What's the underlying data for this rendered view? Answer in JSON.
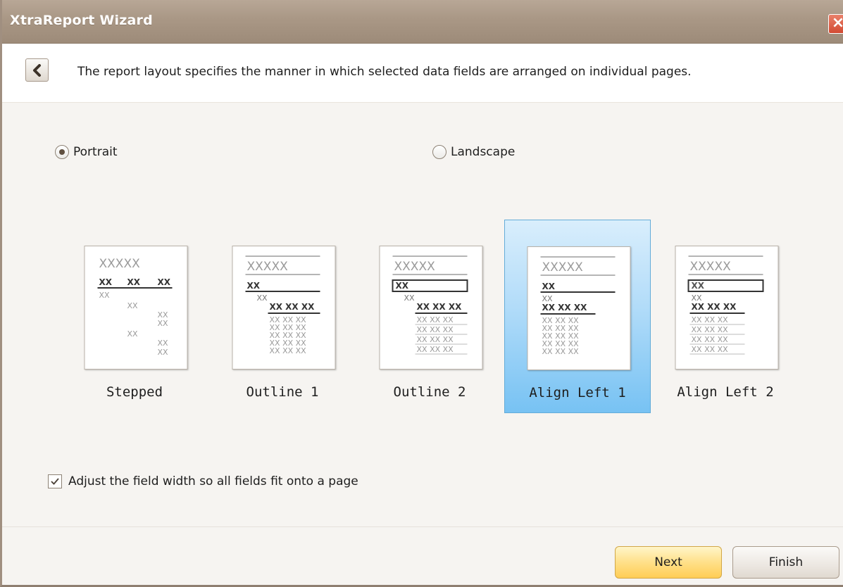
{
  "window": {
    "title": "XtraReport Wizard"
  },
  "header": {
    "description": "The report layout specifies the manner in which selected data fields are arranged on individual pages."
  },
  "orientation": {
    "options": [
      {
        "label": "Portrait",
        "selected": true
      },
      {
        "label": "Landscape",
        "selected": false
      }
    ]
  },
  "layouts": {
    "items": [
      {
        "label": "Stepped",
        "selected": false
      },
      {
        "label": "Outline 1",
        "selected": false
      },
      {
        "label": "Outline 2",
        "selected": false
      },
      {
        "label": "Align Left 1",
        "selected": true
      },
      {
        "label": "Align Left 2",
        "selected": false
      }
    ],
    "thumbnail_text": {
      "title": "XXXXX",
      "field": "XX",
      "fields": "XX XX XX"
    }
  },
  "adjust_width": {
    "label": "Adjust the field width so all fields fit onto a page",
    "checked": true
  },
  "buttons": {
    "next": "Next",
    "finish": "Finish"
  },
  "colors": {
    "titlebar": "#a99785",
    "selected": "#b2dcf9",
    "next_button": "#ffe089"
  }
}
